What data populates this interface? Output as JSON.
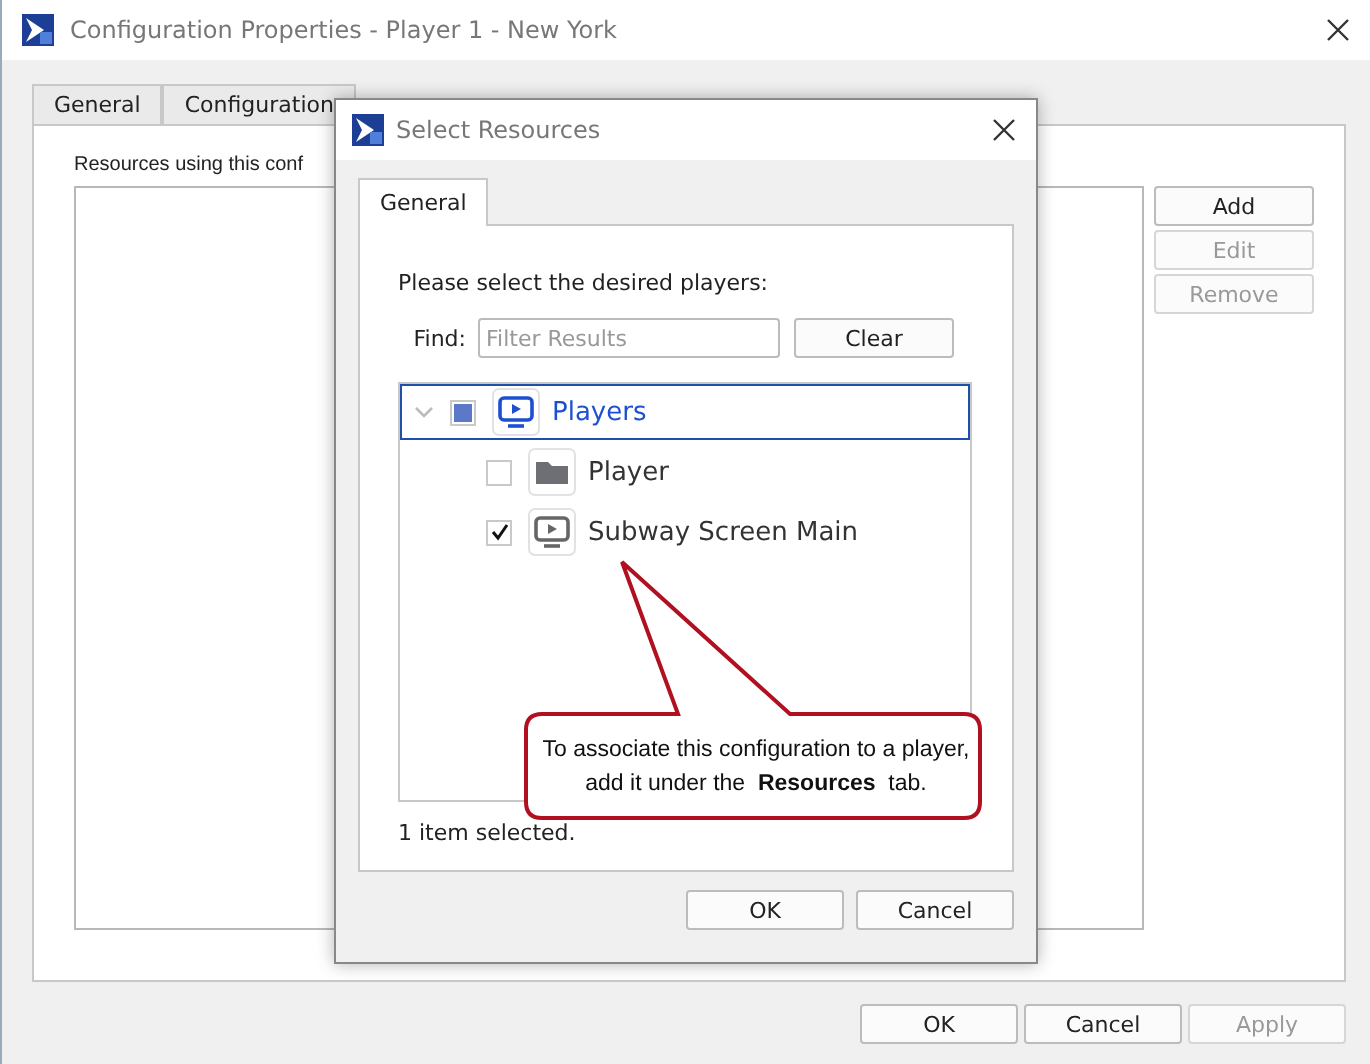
{
  "window": {
    "title": "Configuration Properties - Player 1 - New York"
  },
  "tabs": [
    {
      "label": "General",
      "selected": false
    },
    {
      "label": "Configuration",
      "selected": false
    }
  ],
  "panel": {
    "label": "Resources using this conf",
    "buttons": [
      {
        "label": "Add",
        "disabled": false
      },
      {
        "label": "Edit",
        "disabled": true
      },
      {
        "label": "Remove",
        "disabled": true
      }
    ]
  },
  "footer_buttons": [
    {
      "label": "OK",
      "disabled": false
    },
    {
      "label": "Cancel",
      "disabled": false
    },
    {
      "label": "Apply",
      "disabled": true
    }
  ],
  "dialog": {
    "title": "Select Resources",
    "tabs": [
      {
        "label": "General",
        "selected": true
      }
    ],
    "prompt": "Please select the desired players:",
    "find_label": "Find:",
    "search": {
      "placeholder": "Filter Results"
    },
    "clear_button": "Clear",
    "tree": [
      {
        "label": "Players",
        "kind": "player",
        "checked": false,
        "mixed": true,
        "selected": true,
        "expanded": true,
        "children": [
          {
            "label": "Player",
            "kind": "folder",
            "checked": false,
            "mixed": false,
            "selected": false
          },
          {
            "label": "Subway Screen Main",
            "kind": "player",
            "checked": true,
            "mixed": false,
            "selected": false
          }
        ]
      }
    ],
    "status": "1 item selected.",
    "buttons": [
      {
        "label": "OK"
      },
      {
        "label": "Cancel"
      }
    ]
  },
  "callout": {
    "text": "To associate this configuration to a player, add it under the  **Resources**  tab."
  }
}
